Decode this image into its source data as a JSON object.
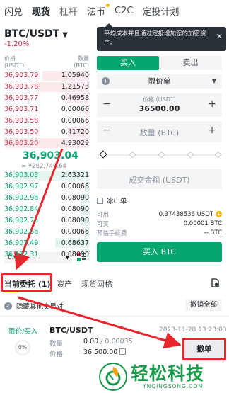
{
  "tabs": [
    "闪兑",
    "现货",
    "杠杆",
    "法币",
    "C2C",
    "定投计划"
  ],
  "active_tab": 1,
  "dot_tab": 3,
  "pair": {
    "name": "BTC/USDT",
    "change": "-1.20%"
  },
  "orderbook": {
    "price_label": "价格\n(USDT)",
    "qty_label": "数量\n(BTC)",
    "asks": [
      {
        "price": "36,903.79",
        "qty": "1.05940",
        "depth": 0.55
      },
      {
        "price": "36,903.78",
        "qty": "1.21573",
        "depth": 0.6
      },
      {
        "price": "36,903.77",
        "qty": "0.46958",
        "depth": 0.3
      },
      {
        "price": "36,903.71",
        "qty": "0.00066",
        "depth": 0.05
      },
      {
        "price": "36,903.58",
        "qty": "0.00066",
        "depth": 0.05
      },
      {
        "price": "36,903.50",
        "qty": "0.41720",
        "depth": 0.25
      },
      {
        "price": "36,903.20",
        "qty": "4.93029",
        "depth": 1.0
      }
    ],
    "mid_price": "36,903.04",
    "mid_sub": "≈ ¥262,749.64",
    "bids": [
      {
        "price": "36,903.03",
        "qty": "2.63321",
        "depth": 0.9
      },
      {
        "price": "36,902.97",
        "qty": "0.00066",
        "depth": 0.05
      },
      {
        "price": "36,902.96",
        "qty": "0.08090",
        "depth": 0.1
      },
      {
        "price": "36,902.84",
        "qty": "0.08090",
        "depth": 0.1
      },
      {
        "price": "36,902.75",
        "qty": "0.08090",
        "depth": 0.1
      },
      {
        "price": "36,902.66",
        "qty": "0.00066",
        "depth": 0.05
      },
      {
        "price": "36,902.49",
        "qty": "0.68637",
        "depth": 0.4
      },
      {
        "price": "36,902.31",
        "qty": "0.08090",
        "depth": 0.1
      }
    ],
    "precision": "0.01"
  },
  "banner": {
    "text": "平均成本并且通过定投增加您的加密资产。"
  },
  "trade": {
    "buy_tab": "买入",
    "sell_tab": "卖出",
    "order_type": "限价单",
    "price_label": "价格 (USDT)",
    "price_value": "36500.00",
    "amount_placeholder": "数量 (BTC)",
    "total_placeholder": "成交金额 (USDT)",
    "iceberg": "冰山单",
    "available_label": "可用",
    "available_value": "0.37438536 USDT",
    "can_buy_label": "可买",
    "can_buy_value": "0.00001 BTC",
    "fee_label": "预估手续费",
    "fee_value": "-- BTC",
    "buy_button": "买入 BTC",
    "slider_level": 0
  },
  "orders": {
    "tabs": [
      "当前委托 (1)",
      "资产",
      "现货网格"
    ],
    "hide_others": "隐藏其他交易对",
    "cancel_all": "撤销全部",
    "item": {
      "type": "限价/买入",
      "pair": "BTC/USDT",
      "time": "2023-11-28 13:23:03",
      "progress": "0%",
      "qty_label": "数量",
      "qty_filled": "0.00",
      "qty_total": " / 0.00035",
      "price_label": "价格",
      "price_value": "36,500.00",
      "revoke": "撤单"
    }
  },
  "watermark": {
    "text": "轻松科技",
    "sub": "YNQINGSONG.COM"
  },
  "colors": {
    "up": "#03a66d",
    "down": "#cf304a",
    "accent": "#f0b90b",
    "highlight": "#e8262b"
  }
}
